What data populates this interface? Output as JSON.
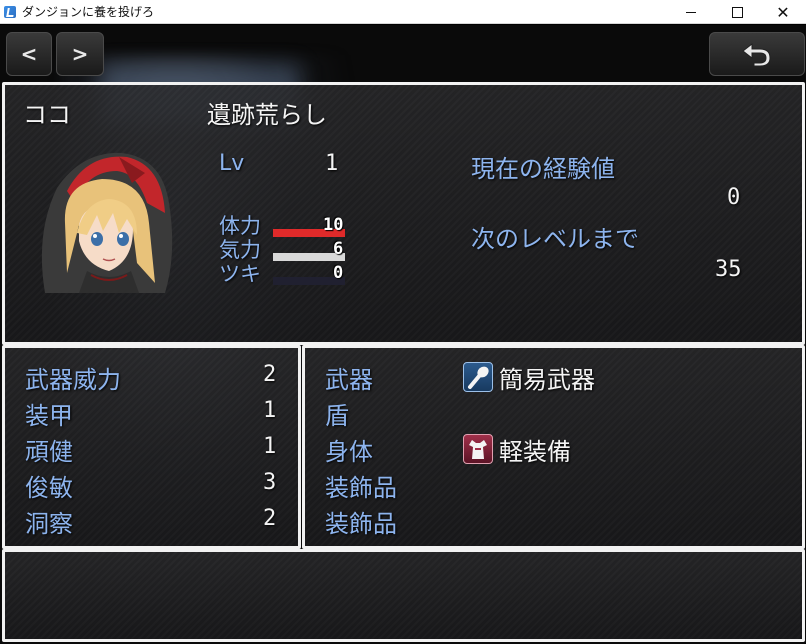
{
  "window": {
    "title": "ダンジョンに養を投げろ",
    "minimize": "",
    "maximize": "",
    "close": "✕"
  },
  "nav": {
    "prev": "<",
    "next": ">",
    "back": "⮌"
  },
  "actor": {
    "name": "ココ",
    "class": "遺跡荒らし",
    "level_label": "Lv",
    "level": "1",
    "exp_current_label": "現在の経験値",
    "exp_current": "0",
    "exp_next_label": "次のレベルまで",
    "exp_next": "35",
    "gauges": [
      {
        "label": "体力",
        "value": "10",
        "fill": 1.0,
        "color": "#e02a2a"
      },
      {
        "label": "気力",
        "value": "6",
        "fill": 1.0,
        "color": "#d9d9d9"
      },
      {
        "label": "ツキ",
        "value": "0",
        "fill": 0.0,
        "color": "#4a4a8a"
      }
    ]
  },
  "params": [
    {
      "label": "武器威力",
      "value": "2"
    },
    {
      "label": "装甲",
      "value": "1"
    },
    {
      "label": "頑健",
      "value": "1"
    },
    {
      "label": "俊敏",
      "value": "3"
    },
    {
      "label": "洞察",
      "value": "2"
    }
  ],
  "equipment": [
    {
      "slot": "武器",
      "item": "簡易武器",
      "icon": "club-icon"
    },
    {
      "slot": "盾",
      "item": "",
      "icon": ""
    },
    {
      "slot": "身体",
      "item": "軽装備",
      "icon": "armor-icon"
    },
    {
      "slot": "装飾品",
      "item": "",
      "icon": ""
    },
    {
      "slot": "装飾品",
      "item": "",
      "icon": ""
    }
  ],
  "help": {
    "text": ""
  },
  "colors": {
    "system_blue": "#8db4ee",
    "hp": "#e02a2a",
    "mp": "#d9d9d9",
    "luck": "#4a4a8a"
  }
}
